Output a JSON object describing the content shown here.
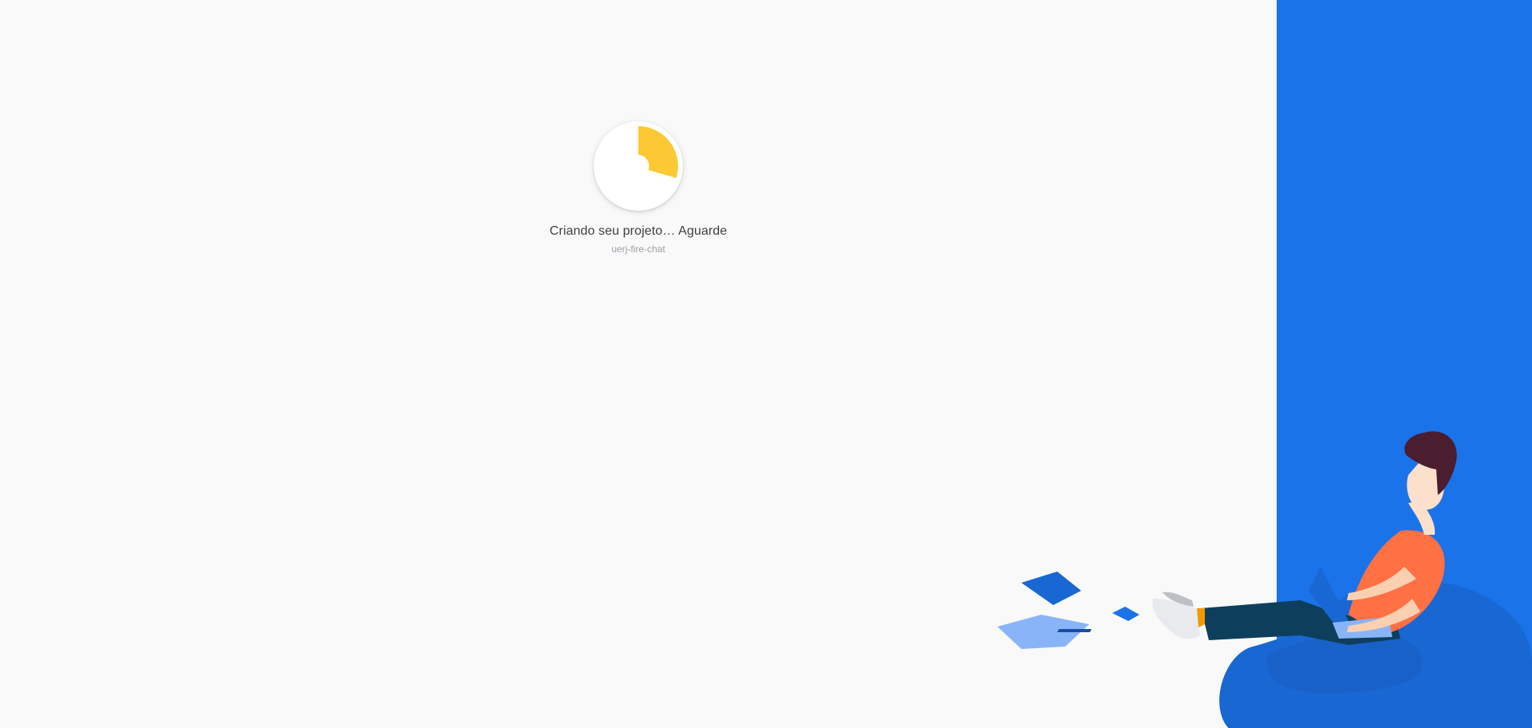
{
  "loader": {
    "title": "Criando seu projeto… Aguarde",
    "project_id": "uerj-fire-chat",
    "progress": 0.25,
    "progress_color": "#fcc934"
  },
  "theme": {
    "page_background": "#f9f9f9",
    "panel_color": "#1a73e8"
  },
  "illustration": {
    "name": "person-with-laptop-illustration"
  }
}
